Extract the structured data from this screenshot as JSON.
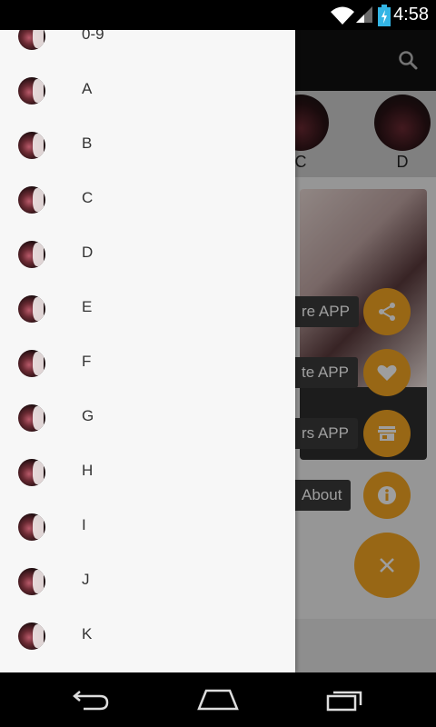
{
  "status_bar": {
    "time": "4:58"
  },
  "drawer": {
    "items": [
      {
        "label": "0-9"
      },
      {
        "label": "A"
      },
      {
        "label": "B"
      },
      {
        "label": "C"
      },
      {
        "label": "D"
      },
      {
        "label": "E"
      },
      {
        "label": "F"
      },
      {
        "label": "G"
      },
      {
        "label": "H"
      },
      {
        "label": "I"
      },
      {
        "label": "J"
      },
      {
        "label": "K"
      }
    ]
  },
  "background_app": {
    "letters": [
      {
        "label": "C"
      },
      {
        "label": "D"
      }
    ],
    "fab_menu": {
      "share_label": "re APP",
      "rate_label": "te APP",
      "others_label": "rs APP",
      "about_label": "About"
    }
  },
  "colors": {
    "fab": "#f5a623",
    "drawer_bg": "#f7f7f7",
    "toolbar": "#111111"
  },
  "icons": {
    "status": [
      "wifi-icon",
      "signal-icon",
      "battery-charging-icon"
    ],
    "toolbar": "search-icon",
    "fab": [
      "share-icon",
      "heart-icon",
      "store-icon",
      "info-icon",
      "close-icon"
    ],
    "nav": [
      "back-icon",
      "home-icon",
      "recent-apps-icon"
    ]
  }
}
